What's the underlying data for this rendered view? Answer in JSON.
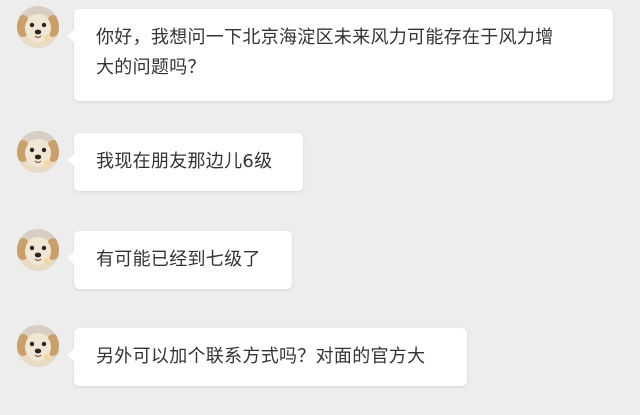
{
  "messages": [
    {
      "sender_avatar": "dog-avatar",
      "text": "你好，我想问一下北京海淀区未来风力可能存在于风力增\n大的问题吗？"
    },
    {
      "sender_avatar": "dog-avatar",
      "text": "我现在朋友那边儿6级"
    },
    {
      "sender_avatar": "dog-avatar",
      "text": "有可能已经到七级了"
    },
    {
      "sender_avatar": "dog-avatar",
      "text": "另外可以加个联系方式吗？对面的官方大"
    }
  ],
  "colors": {
    "background": "#ededed",
    "bubble": "#ffffff",
    "text": "#333333"
  }
}
